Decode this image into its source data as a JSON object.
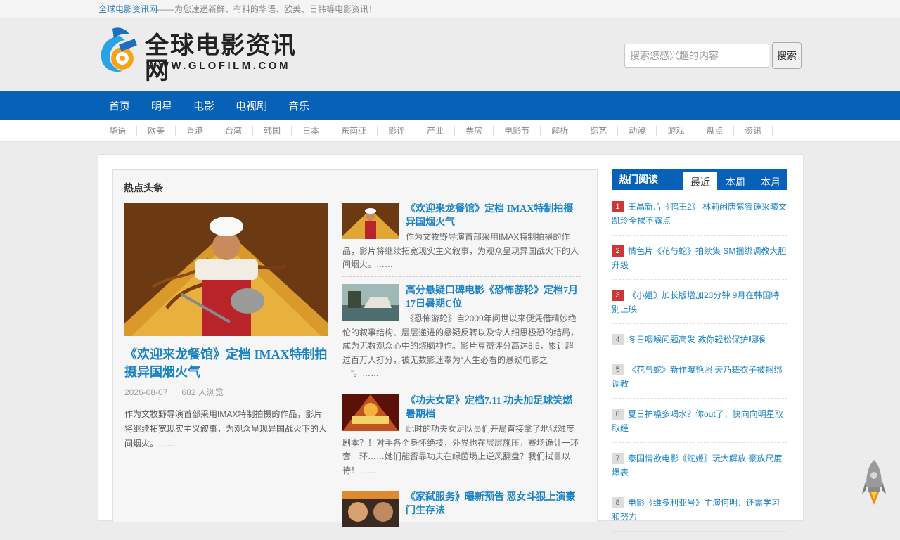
{
  "topbar": {
    "site": "全球电影资讯网",
    "slogan": "——为您速递新鲜、有料的华语、欧美、日韩等电影资讯！"
  },
  "logo": {
    "word": "全球电影资讯网",
    "url": "WWW.GLOFILM.COM"
  },
  "search": {
    "placeholder": "搜索您感兴趣的内容",
    "button": "搜索"
  },
  "nav": [
    "首页",
    "明星",
    "电影",
    "电视剧",
    "音乐"
  ],
  "subnav": [
    "华语",
    "欧美",
    "香港",
    "台湾",
    "韩国",
    "日本",
    "东南亚",
    "影评",
    "产业",
    "票房",
    "电影节",
    "解析",
    "综艺",
    "动漫",
    "游戏",
    "盘点",
    "资讯"
  ],
  "hot": {
    "title": "热点头条",
    "big": {
      "title": "《欢迎来龙餐馆》定档 IMAX特制拍摄异国烟火气",
      "date": "2026-08-07",
      "views": "682 人浏览",
      "desc": "作为文牧野导演首部采用IMAX特制拍摄的作品，影片将继续拓宽现实主义叙事，为观众呈现异国战火下的人间烟火。……"
    },
    "items": [
      {
        "title": "《欢迎来龙餐馆》定档 IMAX特制拍摄异国烟火气",
        "desc": "作为文牧野导演首部采用IMAX特制拍摄的作品，影片将继续拓宽现实主义叙事，为观众呈现异国战火下的人间烟火。……"
      },
      {
        "title": "高分悬疑口碑电影《恐怖游轮》定档7月17日暑期C位",
        "desc": "《恐怖游轮》自2009年问世以来便凭借精妙绝伦的叙事结构、层层递进的悬疑反转以及令人细思极恐的结局，成为无数观众心中的烧脑神作。影片豆瓣评分高达8.5，累计超过百万人打分，被无数影迷奉为“人生必看的悬疑电影之一”。……"
      },
      {
        "title": "《功夫女足》定档7.11 功夫加足球笑燃暑期档",
        "desc": "此时的功夫女足队员们开局直接拿了地狱难度剧本？！对手各个身怀绝技，外界也在层层施压，赛场诡计一环套一环……她们能否靠功夫在绿茵场上逆风翻盘？我们拭目以待！……"
      },
      {
        "title": "《家弑服务》曝新预告 恶女斗狠上演豪门生存法",
        "desc": ""
      }
    ]
  },
  "side": {
    "title": "热门阅读",
    "tabs": [
      "最近",
      "本周",
      "本月"
    ],
    "list": [
      {
        "n": "1",
        "text": "王晶新片《鸭王2》 林莉闲唐紫睿锤采曦文凯玲全裸不露点"
      },
      {
        "n": "2",
        "text": "情色片《花与蛇》拍续集 SM捆绑调教大胆升级"
      },
      {
        "n": "3",
        "text": "《小姐》加长版增加23分钟 9月在韩国特别上映"
      },
      {
        "n": "4",
        "text": "冬日咽喉问题高发 教你轻松保护咽喉"
      },
      {
        "n": "5",
        "text": "《花与蛇》新作曝艳照 天乃舞衣子被捆绑调教"
      },
      {
        "n": "6",
        "text": "夏日护嗓多喝水？你out了，快向向明星取取经"
      },
      {
        "n": "7",
        "text": "泰国情欲电影《蛇姬》玩大解放 豪放尺度爆表"
      },
      {
        "n": "8",
        "text": "电影《维多利亚号》主演何明：还需学习和努力"
      }
    ]
  },
  "colors": {
    "brand_blue": "#0762b7",
    "link_blue": "#1a82c5",
    "rank_red": "#cf3535"
  }
}
